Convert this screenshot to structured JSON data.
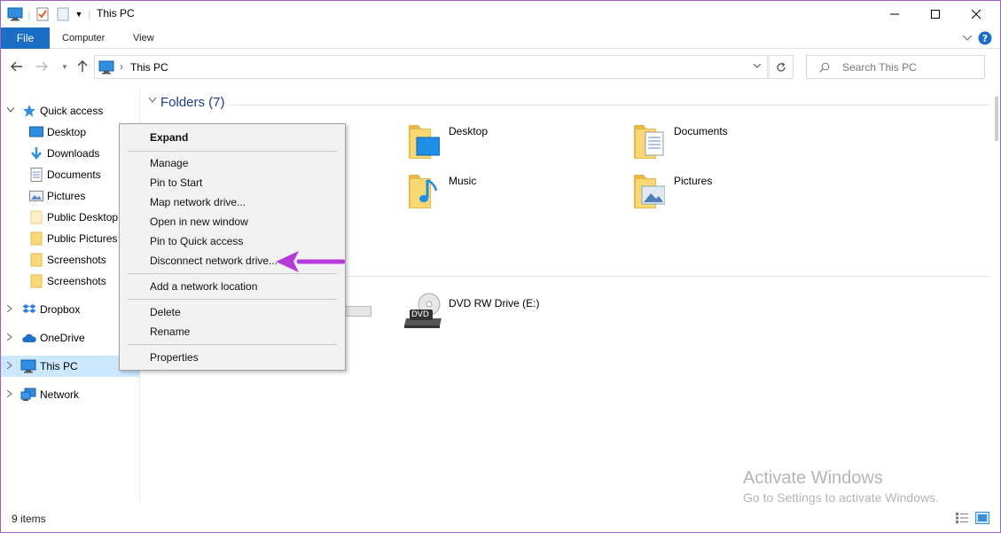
{
  "window": {
    "title": "This PC"
  },
  "ribbon": {
    "file": "File",
    "computer": "Computer",
    "view": "View"
  },
  "address": {
    "location": "This PC",
    "search_placeholder": "Search This PC"
  },
  "sidebar": {
    "items": [
      {
        "label": "Quick access"
      },
      {
        "label": "Desktop"
      },
      {
        "label": "Downloads"
      },
      {
        "label": "Documents"
      },
      {
        "label": "Pictures"
      },
      {
        "label": "Public Desktop"
      },
      {
        "label": "Public Pictures"
      },
      {
        "label": "Screenshots"
      },
      {
        "label": "Screenshots"
      },
      {
        "label": "Dropbox"
      },
      {
        "label": "OneDrive"
      },
      {
        "label": "This PC"
      },
      {
        "label": "Network"
      }
    ]
  },
  "main": {
    "folders_group": "Folders (7)",
    "folders": [
      {
        "label": "Desktop"
      },
      {
        "label": "Documents"
      },
      {
        "label": "Music"
      },
      {
        "label": "Pictures"
      }
    ],
    "drive": {
      "label": "DVD RW Drive (E:)",
      "badge": "DVD"
    }
  },
  "context_menu": {
    "items": [
      "Expand",
      "Manage",
      "Pin to Start",
      "Map network drive...",
      "Open in new window",
      "Pin to Quick access",
      "Disconnect network drive...",
      "Add a network location",
      "Delete",
      "Rename",
      "Properties"
    ]
  },
  "status": {
    "items": "9 items"
  },
  "watermark": {
    "line1": "Activate Windows",
    "line2": "Go to Settings to activate Windows."
  },
  "colors": {
    "file_tab": "#1a6ec4",
    "selection": "#cce8ff",
    "folder": "#f6d365",
    "arrow": "#b43bd9"
  }
}
